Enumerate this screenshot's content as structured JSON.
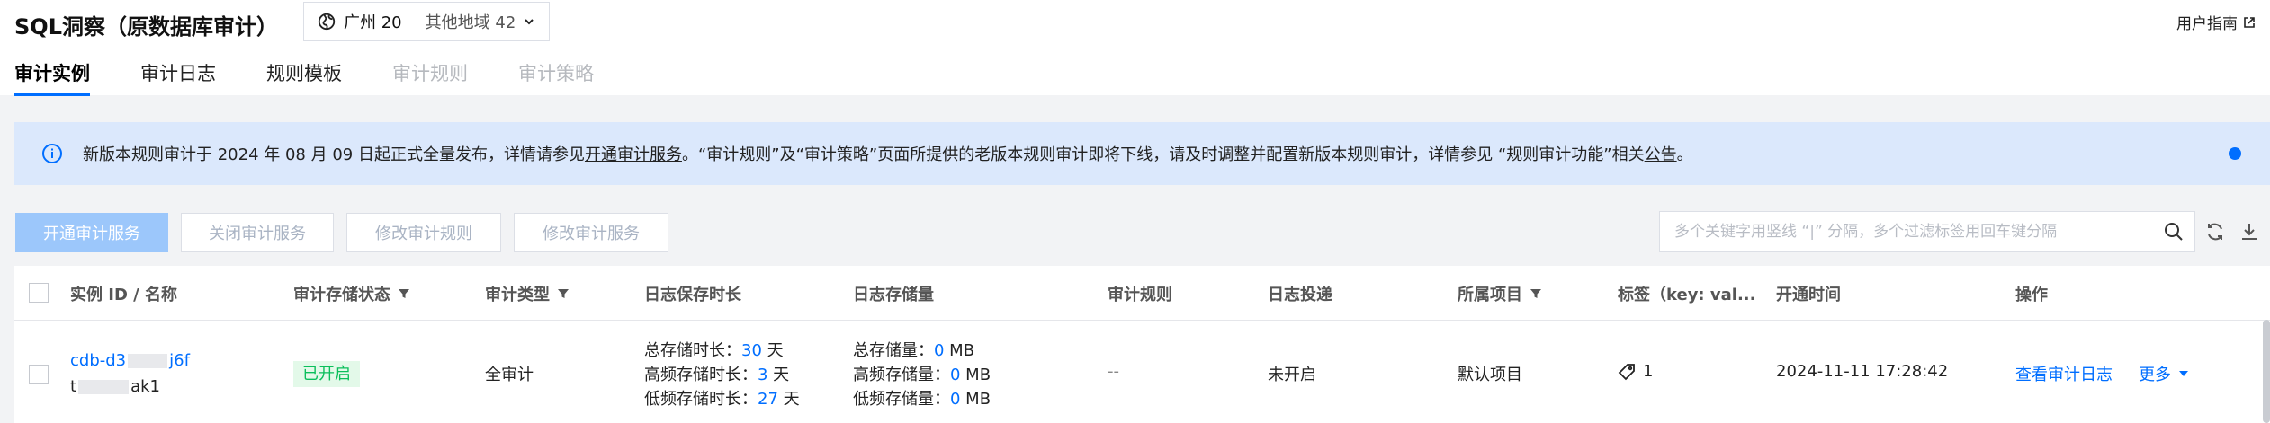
{
  "header": {
    "title": "SQL洞察（原数据库审计）",
    "region": {
      "current": "广州 20",
      "others": "其他地域 42"
    },
    "guide_label": "用户指南"
  },
  "tabs": [
    {
      "label": "审计实例",
      "state": "active"
    },
    {
      "label": "审计日志",
      "state": "normal"
    },
    {
      "label": "规则模板",
      "state": "normal"
    },
    {
      "label": "审计规则",
      "state": "disabled"
    },
    {
      "label": "审计策略",
      "state": "disabled"
    }
  ],
  "notice": {
    "text_1": "新版本规则审计于 2024 年 08 月 09 日起正式全量发布，详情请参见 ",
    "link_1": "开通审计服务",
    "text_2": "。“审计规则”及“审计策略”页面所提供的老版本规则审计即将下线，请及时调整并配置新版本规则审计，详情参见 “规则审计功能”相关",
    "link_2": "公告",
    "text_3": "。"
  },
  "toolbar": {
    "enable_label": "开通审计服务",
    "disable_label": "关闭审计服务",
    "modify_rule_label": "修改审计规则",
    "modify_service_label": "修改审计服务",
    "search_placeholder": "多个关键字用竖线 “|” 分隔，多个过滤标签用回车键分隔"
  },
  "table": {
    "columns": {
      "instance": "实例 ID / 名称",
      "storage_status": "审计存储状态",
      "audit_type": "审计类型",
      "retention": "日志保存时长",
      "storage": "日志存储量",
      "rule": "审计规则",
      "delivery": "日志投递",
      "project": "所属项目",
      "tags": "标签（key: val...",
      "open_time": "开通时间",
      "ops": "操作"
    },
    "rows": [
      {
        "instance_id_prefix": "cdb-d3",
        "instance_id_suffix": "j6f",
        "instance_name_prefix": "t",
        "instance_name_suffix": "ak1",
        "storage_status": "已开启",
        "audit_type": "全审计",
        "retention": {
          "total_label": "总存储时长：",
          "total_value": "30",
          "total_unit": " 天",
          "hot_label": "高频存储时长：",
          "hot_value": "3",
          "hot_unit": " 天",
          "cold_label": "低频存储时长：",
          "cold_value": "27",
          "cold_unit": " 天"
        },
        "storage": {
          "total_label": "总存储量：",
          "total_value": "0",
          "total_unit": " MB",
          "hot_label": "高频存储量：",
          "hot_value": "0",
          "hot_unit": " MB",
          "cold_label": "低频存储量：",
          "cold_value": "0",
          "cold_unit": " MB"
        },
        "rule": "--",
        "delivery": "未开启",
        "project": "默认项目",
        "tags_count": "1",
        "open_time": "2024-11-11 17:28:42",
        "op_view_logs": "查看审计日志",
        "op_more": "更多"
      }
    ]
  },
  "colors": {
    "accent": "#006eff",
    "success": "#0abf5b",
    "notice_bg": "#dbe8fc"
  }
}
